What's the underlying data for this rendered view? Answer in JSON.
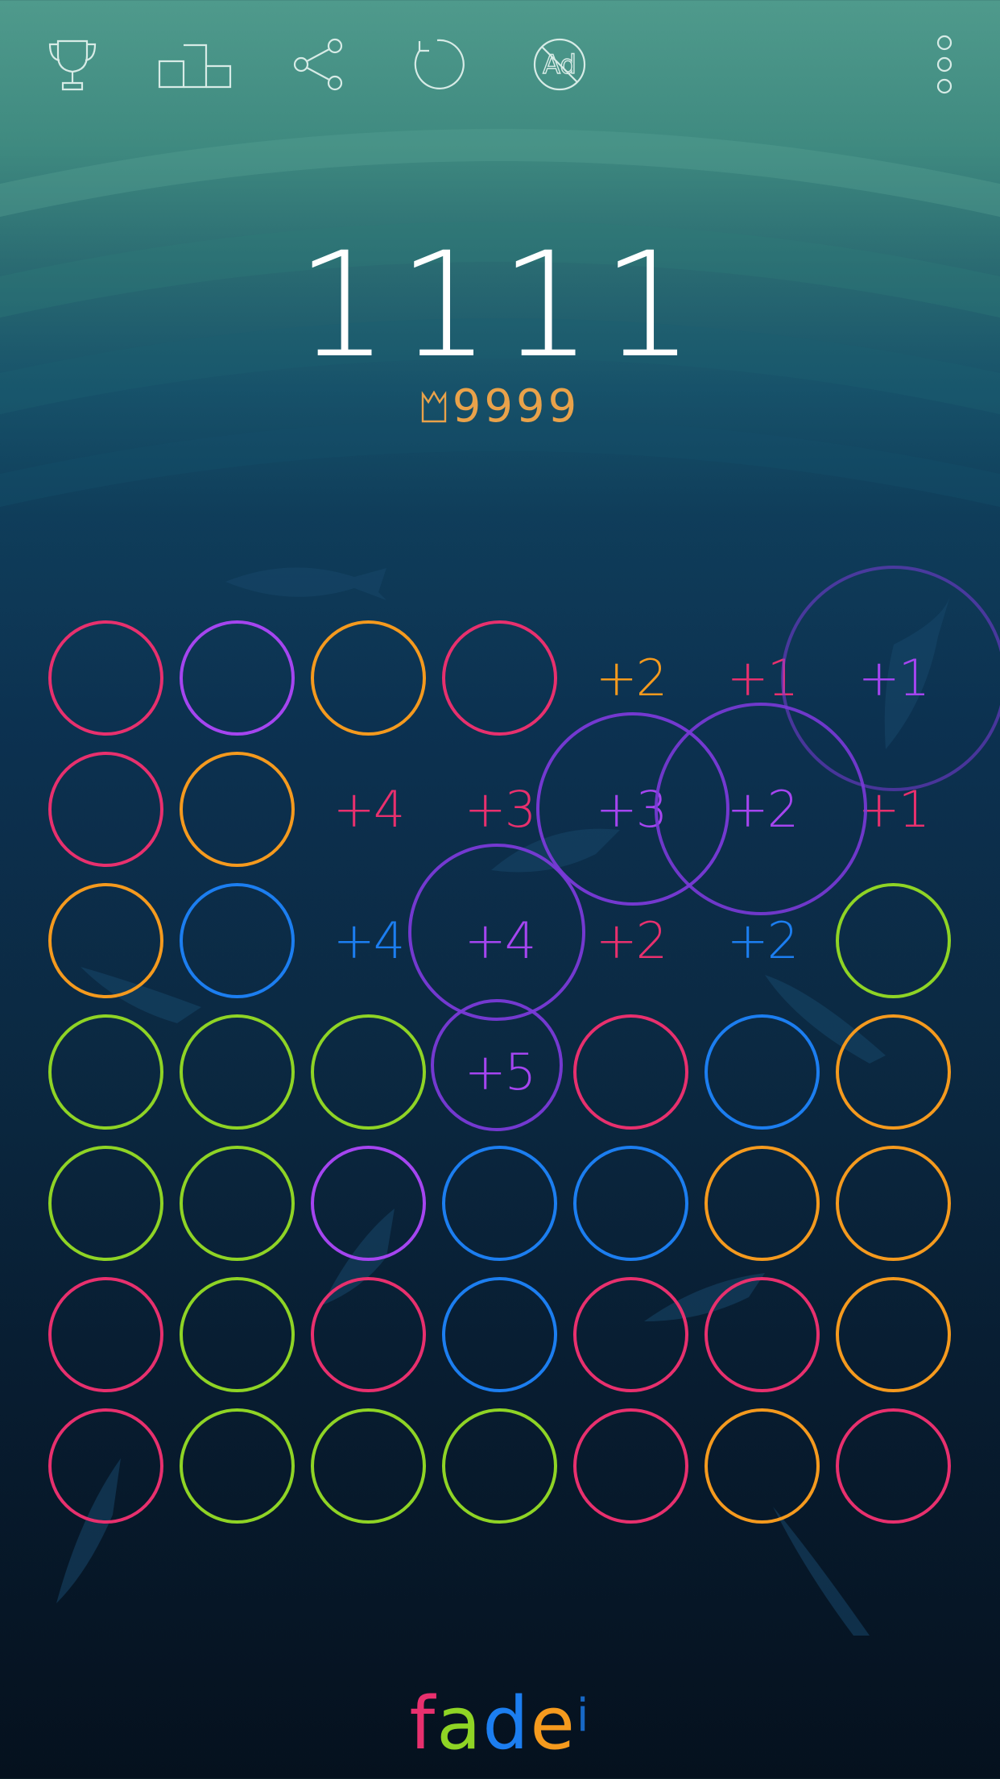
{
  "toolbar": {
    "items": [
      {
        "name": "trophy-icon"
      },
      {
        "name": "leaderboard-icon"
      },
      {
        "name": "share-icon"
      },
      {
        "name": "restart-icon"
      },
      {
        "name": "no-ads-icon",
        "label": "Ad"
      },
      {
        "name": "more-icon"
      }
    ]
  },
  "score": {
    "current": "1111",
    "best": "9999"
  },
  "colors": {
    "pink": "#e8306e",
    "purple": "#a545f0",
    "orange": "#f59a1e",
    "green": "#8fd425",
    "blue": "#1c7ef0",
    "ring": "#7a3ad8"
  },
  "board": {
    "rows": [
      [
        {
          "c": "pink"
        },
        {
          "c": "purple"
        },
        {
          "c": "orange"
        },
        {
          "c": "pink"
        },
        {
          "t": "+2",
          "c": "orange"
        },
        {
          "t": "+1",
          "c": "pink"
        },
        {
          "t": "+1",
          "c": "purple"
        }
      ],
      [
        {
          "c": "pink"
        },
        {
          "c": "orange"
        },
        {
          "t": "+4",
          "c": "pink"
        },
        {
          "t": "+3",
          "c": "pink"
        },
        {
          "t": "+3",
          "c": "purple"
        },
        {
          "t": "+2",
          "c": "purple"
        },
        {
          "t": "+1",
          "c": "pink"
        }
      ],
      [
        {
          "c": "orange"
        },
        {
          "c": "blue"
        },
        {
          "t": "+4",
          "c": "blue"
        },
        {
          "t": "+4",
          "c": "purple"
        },
        {
          "t": "+2",
          "c": "pink"
        },
        {
          "t": "+2",
          "c": "blue"
        },
        {
          "c": "green"
        }
      ],
      [
        {
          "c": "green"
        },
        {
          "c": "green"
        },
        {
          "c": "green"
        },
        {
          "t": "+5",
          "c": "purple"
        },
        {
          "c": "pink"
        },
        {
          "c": "blue"
        },
        {
          "c": "orange"
        }
      ],
      [
        {
          "c": "green"
        },
        {
          "c": "green"
        },
        {
          "c": "purple"
        },
        {
          "c": "blue"
        },
        {
          "c": "blue"
        },
        {
          "c": "orange"
        },
        {
          "c": "orange"
        }
      ],
      [
        {
          "c": "pink"
        },
        {
          "c": "green"
        },
        {
          "c": "pink"
        },
        {
          "c": "blue"
        },
        {
          "c": "pink"
        },
        {
          "c": "pink"
        },
        {
          "c": "orange"
        }
      ],
      [
        {
          "c": "pink"
        },
        {
          "c": "green"
        },
        {
          "c": "green"
        },
        {
          "c": "green"
        },
        {
          "c": "pink"
        },
        {
          "c": "orange"
        },
        {
          "c": "pink"
        }
      ]
    ]
  },
  "logo": {
    "letters": [
      {
        "ch": "f",
        "c": "pink"
      },
      {
        "ch": "a",
        "c": "green"
      },
      {
        "ch": "d",
        "c": "blue"
      },
      {
        "ch": "e",
        "c": "orange"
      },
      {
        "ch": "i",
        "c": "blue"
      }
    ]
  }
}
